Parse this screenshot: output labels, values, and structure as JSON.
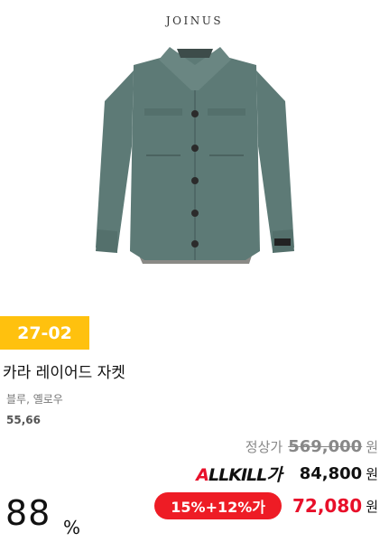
{
  "brand": {
    "logo_text": "JOINUS"
  },
  "product": {
    "image_alt": "카라 레이어드 자켓 image",
    "code": "27-02",
    "name": "카라 레이어드 자켓",
    "colors": "블루, 옐로우",
    "sizes": "55,66"
  },
  "pricing": {
    "original_label": "정상가",
    "original_price": "569,000",
    "currency": "원",
    "allkill_logo": "ALLKILL가",
    "allkill_price": "84,800",
    "discount_badge": "15%+12%가",
    "final_price": "72,080"
  },
  "rating": {
    "value": "88",
    "unit": "%"
  },
  "colors": {
    "badge_yellow": "#ffc10e",
    "accent_red": "#e8102a",
    "jacket_main": "#5d7a76",
    "jacket_lining": "#8a8a86"
  }
}
